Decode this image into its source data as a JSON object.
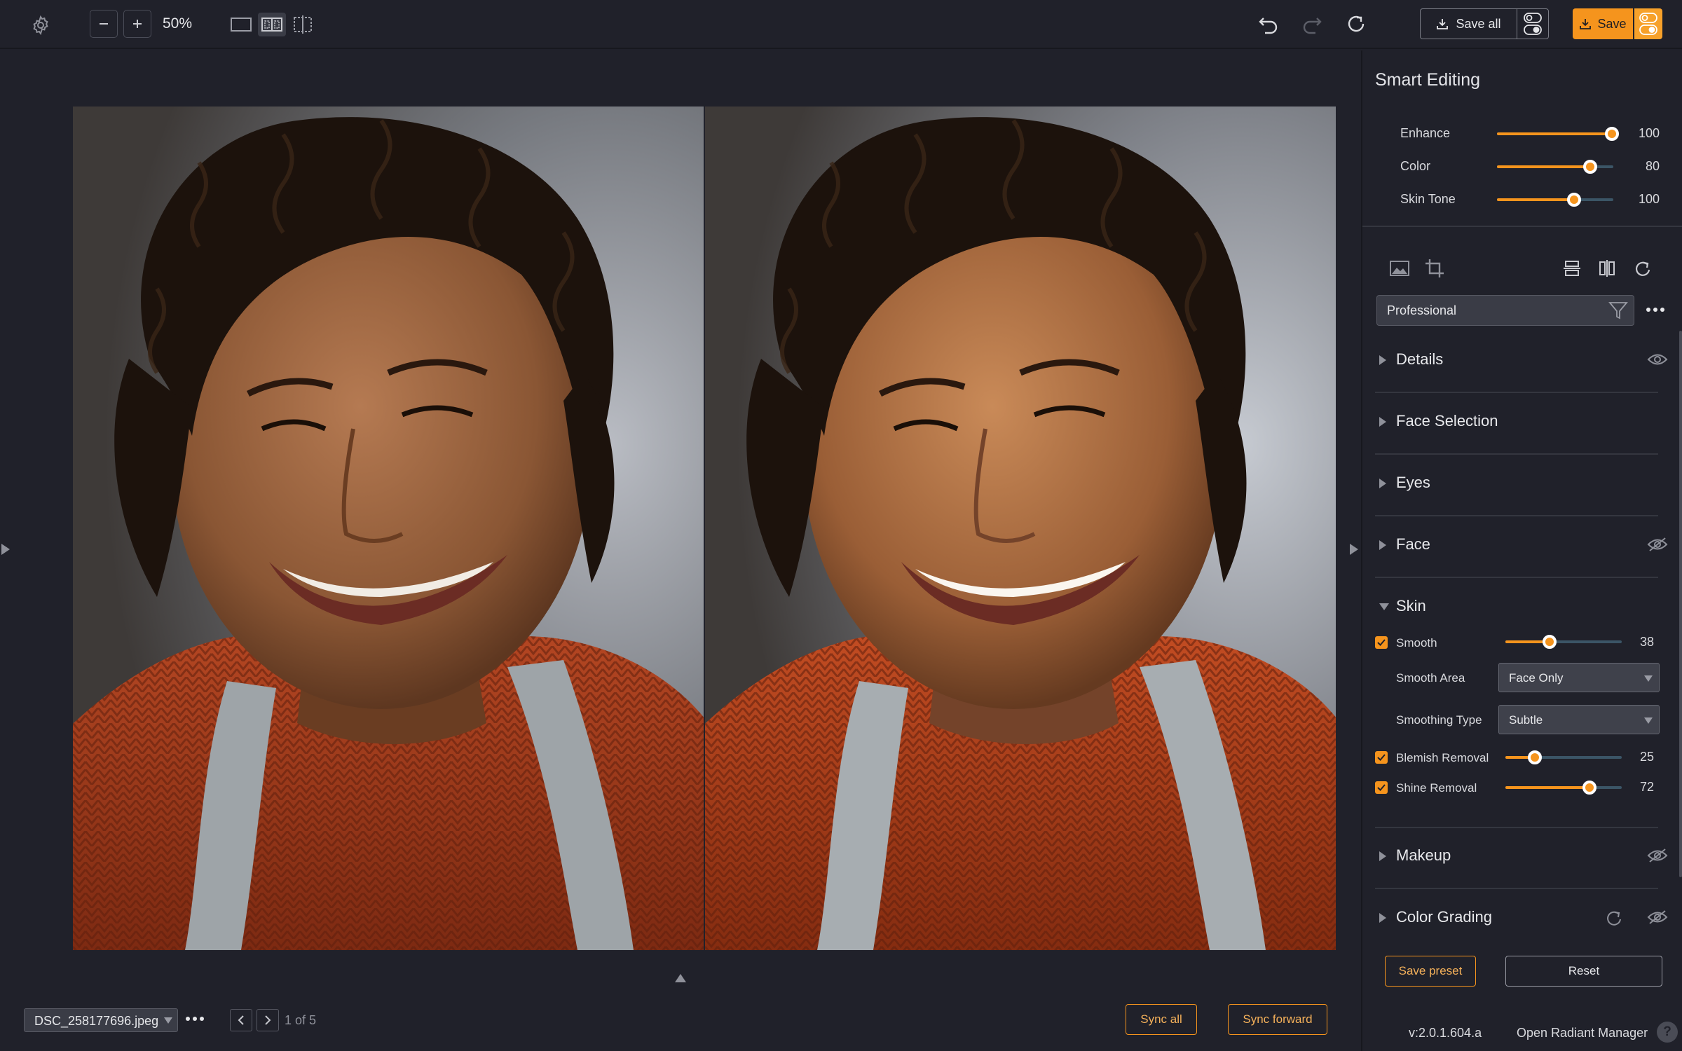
{
  "toolbar": {
    "zoom_level": "50%",
    "save_all_label": "Save all",
    "save_label": "Save"
  },
  "colors": {
    "accent": "#f5941d",
    "background": "#20212a",
    "slider_track": "#3b5566"
  },
  "smart_editing": {
    "title": "Smart Editing",
    "sliders": [
      {
        "label": "Enhance",
        "value": "100",
        "fraction": 0.99
      },
      {
        "label": "Color",
        "value": "80",
        "fraction": 0.8
      },
      {
        "label": "Skin Tone",
        "value": "100",
        "fraction": 0.66
      }
    ]
  },
  "tools": {
    "icons": [
      "image-icon",
      "crop-icon",
      "flip-vertical-icon",
      "flip-horizontal-icon",
      "rotate-icon"
    ]
  },
  "preset": {
    "selected": "Professional"
  },
  "sections": {
    "details": "Details",
    "face_selection": "Face Selection",
    "eyes": "Eyes",
    "face": "Face",
    "skin": "Skin",
    "makeup": "Makeup",
    "color_grading": "Color Grading"
  },
  "skin": {
    "smooth": {
      "label": "Smooth",
      "value": "38",
      "fraction": 0.38
    },
    "smooth_area": {
      "label": "Smooth Area",
      "selected": "Face Only"
    },
    "smoothing_type": {
      "label": "Smoothing Type",
      "selected": "Subtle"
    },
    "blemish_removal": {
      "label": "Blemish Removal",
      "value": "25",
      "fraction": 0.25
    },
    "shine_removal": {
      "label": "Shine Removal",
      "value": "72",
      "fraction": 0.72
    }
  },
  "panel_actions": {
    "save_preset": "Save preset",
    "reset": "Reset"
  },
  "footer": {
    "version": "v:2.0.1.604.a",
    "manager_link": "Open Radiant Manager",
    "help": "?"
  },
  "bottom_bar": {
    "file_name": "DSC_258177696.jpeg",
    "page_indicator": "1 of 5",
    "sync_all": "Sync all",
    "sync_forward": "Sync forward"
  }
}
